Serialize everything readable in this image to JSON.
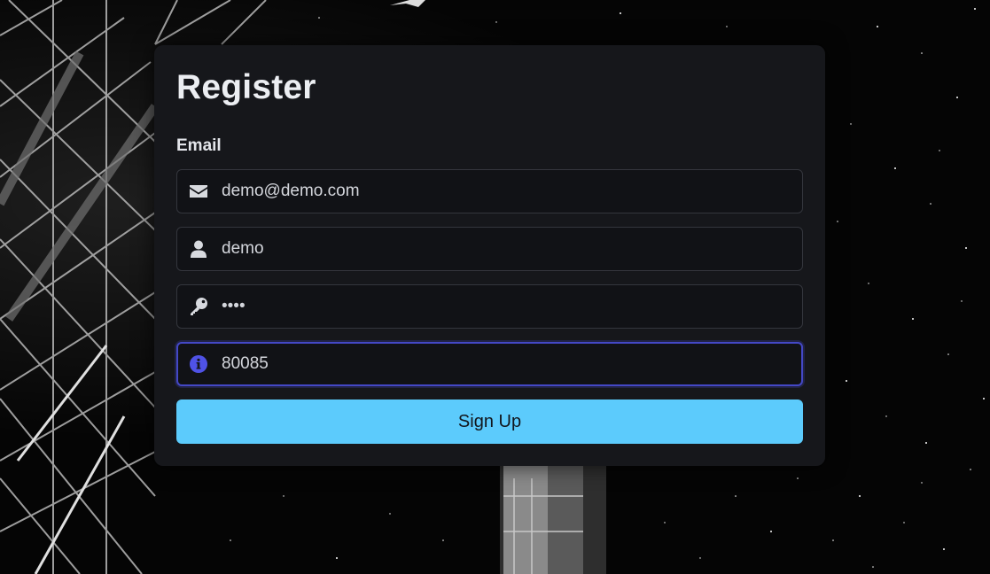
{
  "form": {
    "title": "Register",
    "email_label": "Email",
    "fields": [
      {
        "type": "email",
        "icon": "envelope-icon",
        "value": "demo@demo.com"
      },
      {
        "type": "text",
        "icon": "user-icon",
        "value": "demo"
      },
      {
        "type": "password",
        "icon": "key-icon",
        "value": "demo"
      },
      {
        "type": "text",
        "icon": "info-circle-icon",
        "value": "80085",
        "focused": true
      }
    ],
    "submit_label": "Sign Up"
  },
  "colors": {
    "card_bg": "#16171b",
    "button_bg": "#5ccbfc",
    "focus_accent": "#4448c6",
    "info_icon": "#4f52e6"
  }
}
